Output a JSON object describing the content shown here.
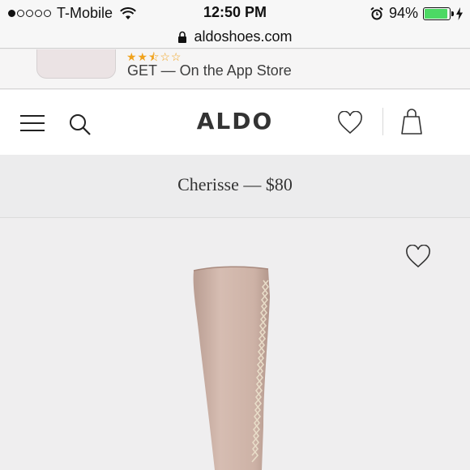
{
  "status_bar": {
    "carrier": "T-Mobile",
    "time": "12:50 PM",
    "battery_percent": "94%",
    "battery_level": 0.94,
    "signal_bars_filled": 1,
    "signal_bars_total": 5,
    "battery_color": "#4cd964"
  },
  "browser": {
    "url": "aldoshoes.com"
  },
  "app_banner": {
    "rating_stars": "★★⯪☆☆",
    "cta_text": "GET — On the App Store",
    "star_color": "#f0a21c"
  },
  "header": {
    "logo_text": "ALDO"
  },
  "product": {
    "title": "Cherisse — $80"
  },
  "icons": {
    "menu": "menu-icon",
    "search": "search-icon",
    "wishlist": "heart-icon",
    "bag": "shopping-bag-icon",
    "favorite": "heart-icon"
  }
}
